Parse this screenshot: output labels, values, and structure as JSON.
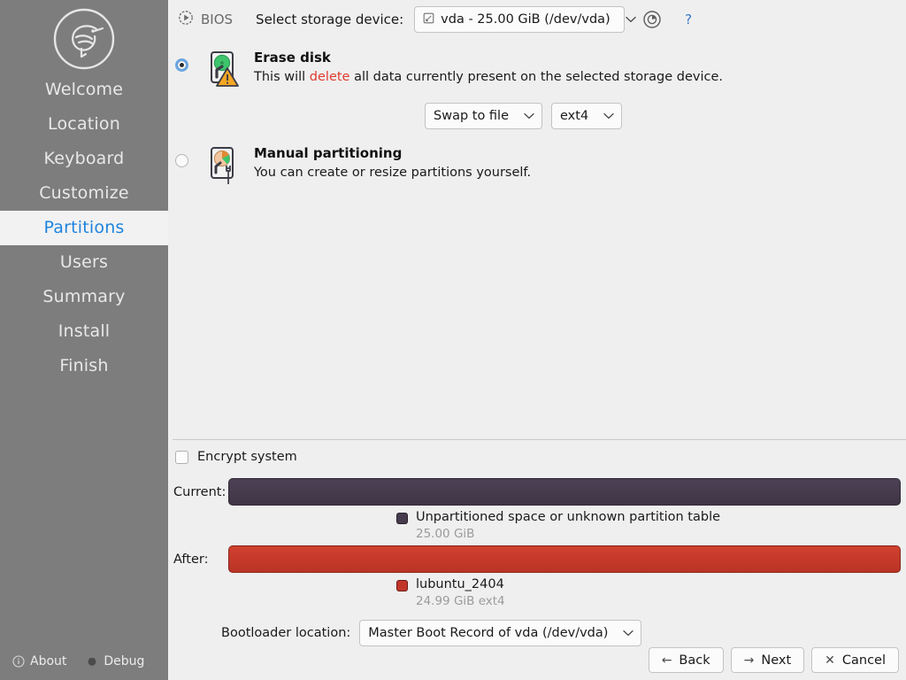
{
  "app": {
    "title": "Lubuntu Installer - Partitions",
    "accent_color": "#1f84de",
    "sidebar_bg": "#7d7d7d",
    "danger_color": "#e03a2f",
    "current_bar_color": "#463c4e",
    "after_bar_color": "#c2362a"
  },
  "sidebar": {
    "logo_name": "lubuntu-bird-logo",
    "items": [
      {
        "label": "Welcome",
        "active": false
      },
      {
        "label": "Location",
        "active": false
      },
      {
        "label": "Keyboard",
        "active": false
      },
      {
        "label": "Customize",
        "active": false
      },
      {
        "label": "Partitions",
        "active": true
      },
      {
        "label": "Users",
        "active": false
      },
      {
        "label": "Summary",
        "active": false
      },
      {
        "label": "Install",
        "active": false
      },
      {
        "label": "Finish",
        "active": false
      }
    ],
    "footer": {
      "about_label": "About",
      "debug_label": "Debug"
    }
  },
  "toolbar": {
    "firmware_label": "BIOS",
    "storage_device_label": "Select storage device:",
    "storage_device_value": "vda - 25.00 GiB (/dev/vda)",
    "help_label": "?"
  },
  "options": {
    "erase": {
      "title": "Erase disk",
      "desc_before": "This will ",
      "desc_danger": "delete",
      "desc_after": " all data currently present on the selected storage device.",
      "selected": true,
      "swap_value": "Swap to file",
      "filesystem_value": "ext4"
    },
    "manual": {
      "title": "Manual partitioning",
      "desc": "You can create or resize partitions yourself.",
      "selected": false
    }
  },
  "encrypt": {
    "label": "Encrypt system",
    "checked": false
  },
  "preview": {
    "current_label": "Current:",
    "after_label": "After:",
    "current_legend_name": "Unpartitioned space or unknown partition table",
    "current_legend_size": "25.00 GiB",
    "after_legend_name": "lubuntu_2404",
    "after_legend_size": "24.99 GiB  ext4"
  },
  "bootloader": {
    "label": "Bootloader location:",
    "value": "Master Boot Record of vda (/dev/vda)"
  },
  "buttons": {
    "back": "Back",
    "next": "Next",
    "cancel": "Cancel"
  }
}
